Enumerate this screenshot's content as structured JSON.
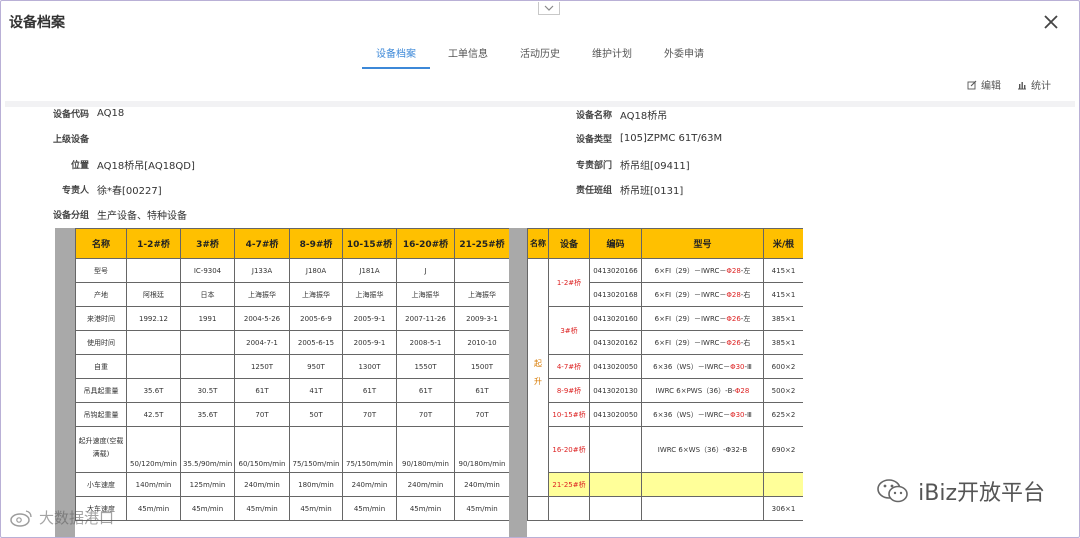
{
  "window": {
    "title": "设备档案"
  },
  "tabs": [
    {
      "label": "设备档案"
    },
    {
      "label": "工单信息"
    },
    {
      "label": "活动历史"
    },
    {
      "label": "维护计划"
    },
    {
      "label": "外委申请"
    }
  ],
  "toolbar": {
    "edit_label": "编辑",
    "stats_label": "统计"
  },
  "fields": {
    "code": {
      "label": "设备代码",
      "value": "AQ18"
    },
    "name": {
      "label": "设备名称",
      "value": "AQ18桥吊"
    },
    "parent": {
      "label": "上级设备",
      "value": ""
    },
    "type": {
      "label": "设备类型",
      "value": "[105]ZPMC 61T/63M"
    },
    "location": {
      "label": "位置",
      "value": "AQ18桥吊[AQ18QD]"
    },
    "dept": {
      "label": "专责部门",
      "value": "桥吊组[09411]"
    },
    "owner": {
      "label": "专责人",
      "value": "徐*春[00227]"
    },
    "team": {
      "label": "责任班组",
      "value": "桥吊班[0131]"
    },
    "group": {
      "label": "设备分组",
      "value": "生产设备、特种设备"
    }
  },
  "spec_table": {
    "headers": [
      "名称",
      "1-2#桥",
      "3#桥",
      "4-7#桥",
      "8-9#桥",
      "10-15#桥",
      "16-20#桥",
      "21-25#桥"
    ],
    "rows": [
      [
        "型号",
        "",
        "IC-9304",
        "J133A",
        "J180A",
        "J181A",
        "J",
        ""
      ],
      [
        "产地",
        "阿根廷",
        "日本",
        "上海振华",
        "上海振华",
        "上海振华",
        "上海振华",
        "上海振华"
      ],
      [
        "来港时间",
        "1992.12",
        "1991",
        "2004-5-26",
        "2005-6-9",
        "2005-9-1",
        "2007-11-26",
        "2009-3-1"
      ],
      [
        "使用时间",
        "",
        "",
        "2004-7-1",
        "2005-6-15",
        "2005-9-1",
        "2008-5-1",
        "2010-10"
      ],
      [
        "自重",
        "",
        "",
        "1250T",
        "950T",
        "1300T",
        "1550T",
        "1500T"
      ],
      [
        "吊具起重量",
        "35.6T",
        "30.5T",
        "61T",
        "41T",
        "61T",
        "61T",
        "61T"
      ],
      [
        "吊钩起重量",
        "42.5T",
        "35.6T",
        "70T",
        "50T",
        "70T",
        "70T",
        "70T"
      ],
      [
        "起升速度(空载满载)",
        "50/120m/min",
        "35.5/90m/min",
        "60/150m/min",
        "75/150m/min",
        "75/150m/min",
        "90/180m/min",
        "90/180m/min"
      ],
      [
        "小车速度",
        "140m/min",
        "125m/min",
        "240m/min",
        "180m/min",
        "240m/min",
        "240m/min",
        "240m/min"
      ],
      [
        "大车速度",
        "45m/min",
        "45m/min",
        "45m/min",
        "45m/min",
        "45m/min",
        "45m/min",
        "45m/min"
      ]
    ]
  },
  "rope_table": {
    "headers": [
      "名称",
      "设备",
      "编码",
      "型号",
      "米/根"
    ],
    "side_label": "起升",
    "rows": [
      {
        "device": "1-2#桥",
        "code": "0413020166",
        "model_pre": "6×FI（29）－IWRC－",
        "model_red": "Φ28",
        "model_post": "-左",
        "length": "415×1"
      },
      {
        "device": "",
        "code": "0413020168",
        "model_pre": "6×FI（29）－IWRC－",
        "model_red": "Φ28",
        "model_post": "-右",
        "length": "415×1"
      },
      {
        "device": "3#桥",
        "code": "0413020160",
        "model_pre": "6×FI（29）－IWRC－",
        "model_red": "Φ26",
        "model_post": "-左",
        "length": "385×1"
      },
      {
        "device": "",
        "code": "0413020162",
        "model_pre": "6×FI（29）－IWRC－",
        "model_red": "Φ26",
        "model_post": "-右",
        "length": "385×1"
      },
      {
        "device": "4-7#桥",
        "code": "0413020050",
        "model_pre": "6×36（WS）－IWRC－",
        "model_red": "Φ30",
        "model_post": "-Ⅲ",
        "length": "600×2"
      },
      {
        "device": "8-9#桥",
        "code": "0413020130",
        "model_pre": "IWRC 6×PWS（36）-B-",
        "model_red": "Φ28",
        "model_post": "",
        "length": "500×2"
      },
      {
        "device": "10-15#桥",
        "code": "0413020050",
        "model_pre": "6×36（WS）－IWRC－",
        "model_red": "Φ30",
        "model_post": "-Ⅲ",
        "length": "625×2"
      },
      {
        "device": "16-20#桥",
        "code": "",
        "model_pre": "IWRC 6×WS（36）-Φ32-B",
        "model_red": "",
        "model_post": "",
        "length": "690×2"
      },
      {
        "device": "21-25#桥",
        "code": "",
        "model_pre": "",
        "model_red": "",
        "model_post": "",
        "length": ""
      },
      {
        "device": "",
        "code": "",
        "model_pre": "",
        "model_red": "",
        "model_post": "",
        "length": "306×1"
      }
    ]
  },
  "watermarks": {
    "right": "iBiz开放平台",
    "left": "大数据港口"
  }
}
